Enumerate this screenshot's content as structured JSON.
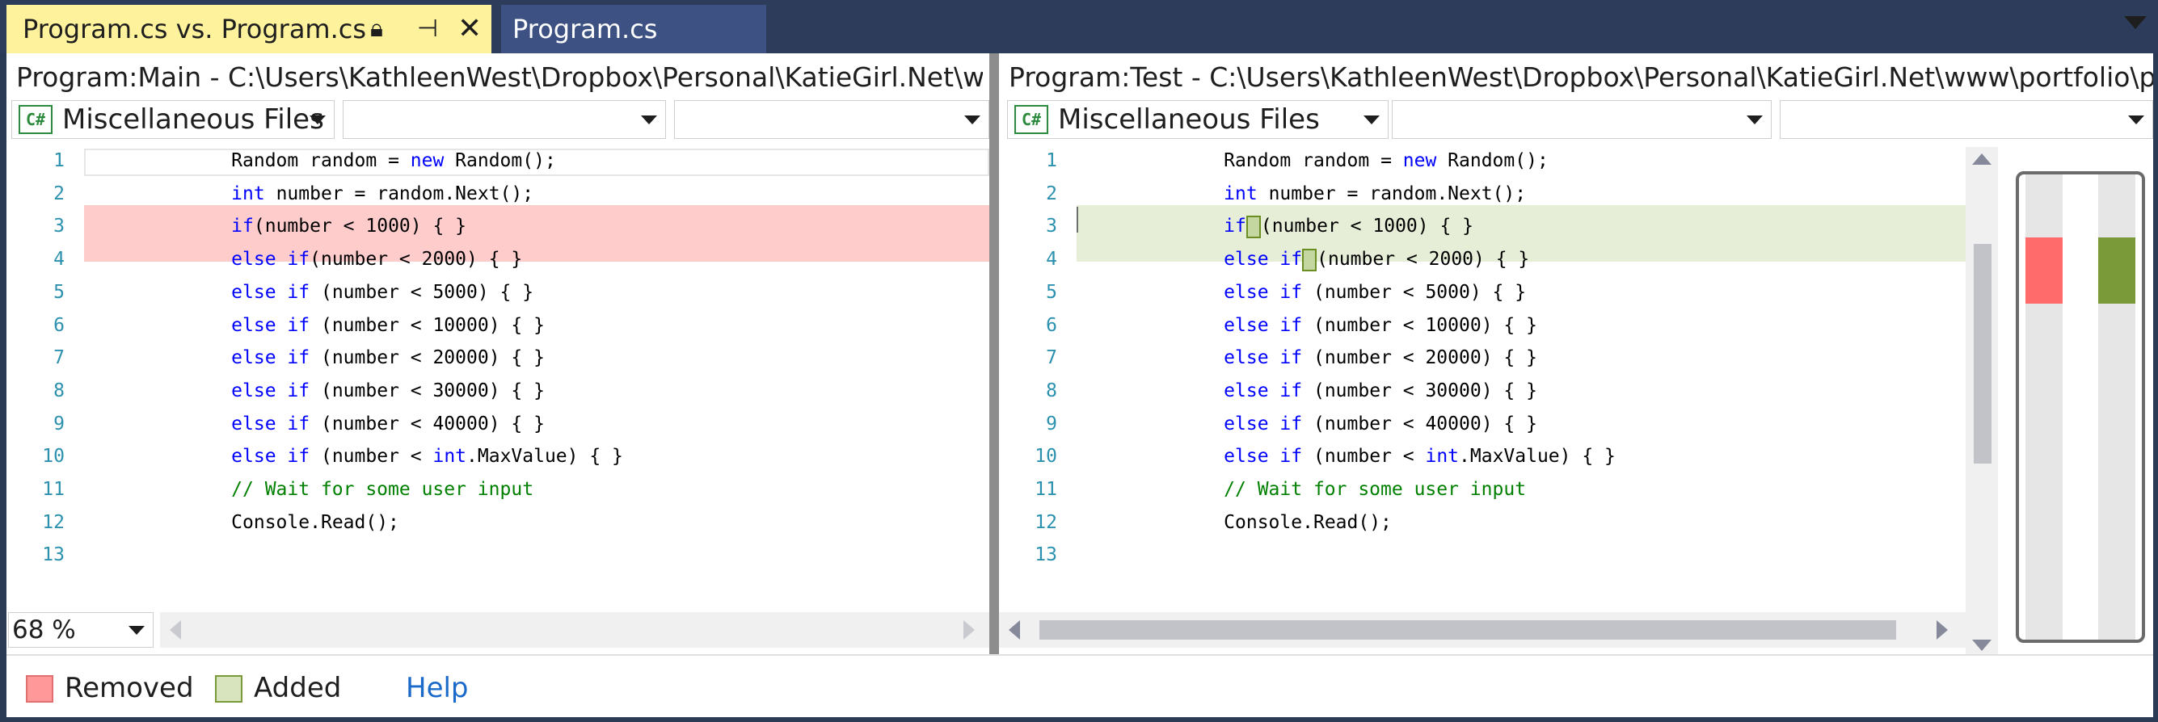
{
  "tabs": {
    "active_label": "Program.cs vs. Program.cs",
    "inactive_label": "Program.cs",
    "icons": [
      "lock-icon",
      "pin-icon",
      "close-icon",
      "chevron-down-icon"
    ]
  },
  "left": {
    "path": "Program:Main - C:\\Users\\KathleenWest\\Dropbox\\Personal\\KatieGirl.Net\\www",
    "project_combo": "Miscellaneous Files",
    "type_combo": "",
    "member_combo": "",
    "zoom": "68 %"
  },
  "right": {
    "path": "Program:Test - C:\\Users\\KathleenWest\\Dropbox\\Personal\\KatieGirl.Net\\www\\portfolio\\pro",
    "project_combo": "Miscellaneous Files",
    "type_combo": "",
    "member_combo": ""
  },
  "code_lines": [
    {
      "n": "1",
      "text": "            Random random = new Random();"
    },
    {
      "n": "2",
      "text": "            int number = random.Next();"
    },
    {
      "n": "3",
      "text": "            if(number < 1000) { }"
    },
    {
      "n": "4",
      "text": "            else if(number < 2000) { }"
    },
    {
      "n": "5",
      "text": "            else if (number < 5000) { }"
    },
    {
      "n": "6",
      "text": "            else if (number < 10000) { }"
    },
    {
      "n": "7",
      "text": "            else if (number < 20000) { }"
    },
    {
      "n": "8",
      "text": "            else if (number < 30000) { }"
    },
    {
      "n": "9",
      "text": "            else if (number < 40000) { }"
    },
    {
      "n": "10",
      "text": "            else if (number < int.MaxValue) { }"
    },
    {
      "n": "11",
      "text": "            // Wait for some user input"
    },
    {
      "n": "12",
      "text": "            Console.Read();"
    },
    {
      "n": "13",
      "text": ""
    }
  ],
  "legend": {
    "removed_label": "Removed",
    "added_label": "Added",
    "help_label": "Help"
  },
  "colors": {
    "removed_line": "#ffcccc",
    "added_line": "#e7eed7",
    "removed_swatch": "#ff6b6b",
    "added_swatch": "#7a9a3a",
    "keyword": "#0000ff",
    "comment": "#008000",
    "line_number": "#2b91af"
  }
}
